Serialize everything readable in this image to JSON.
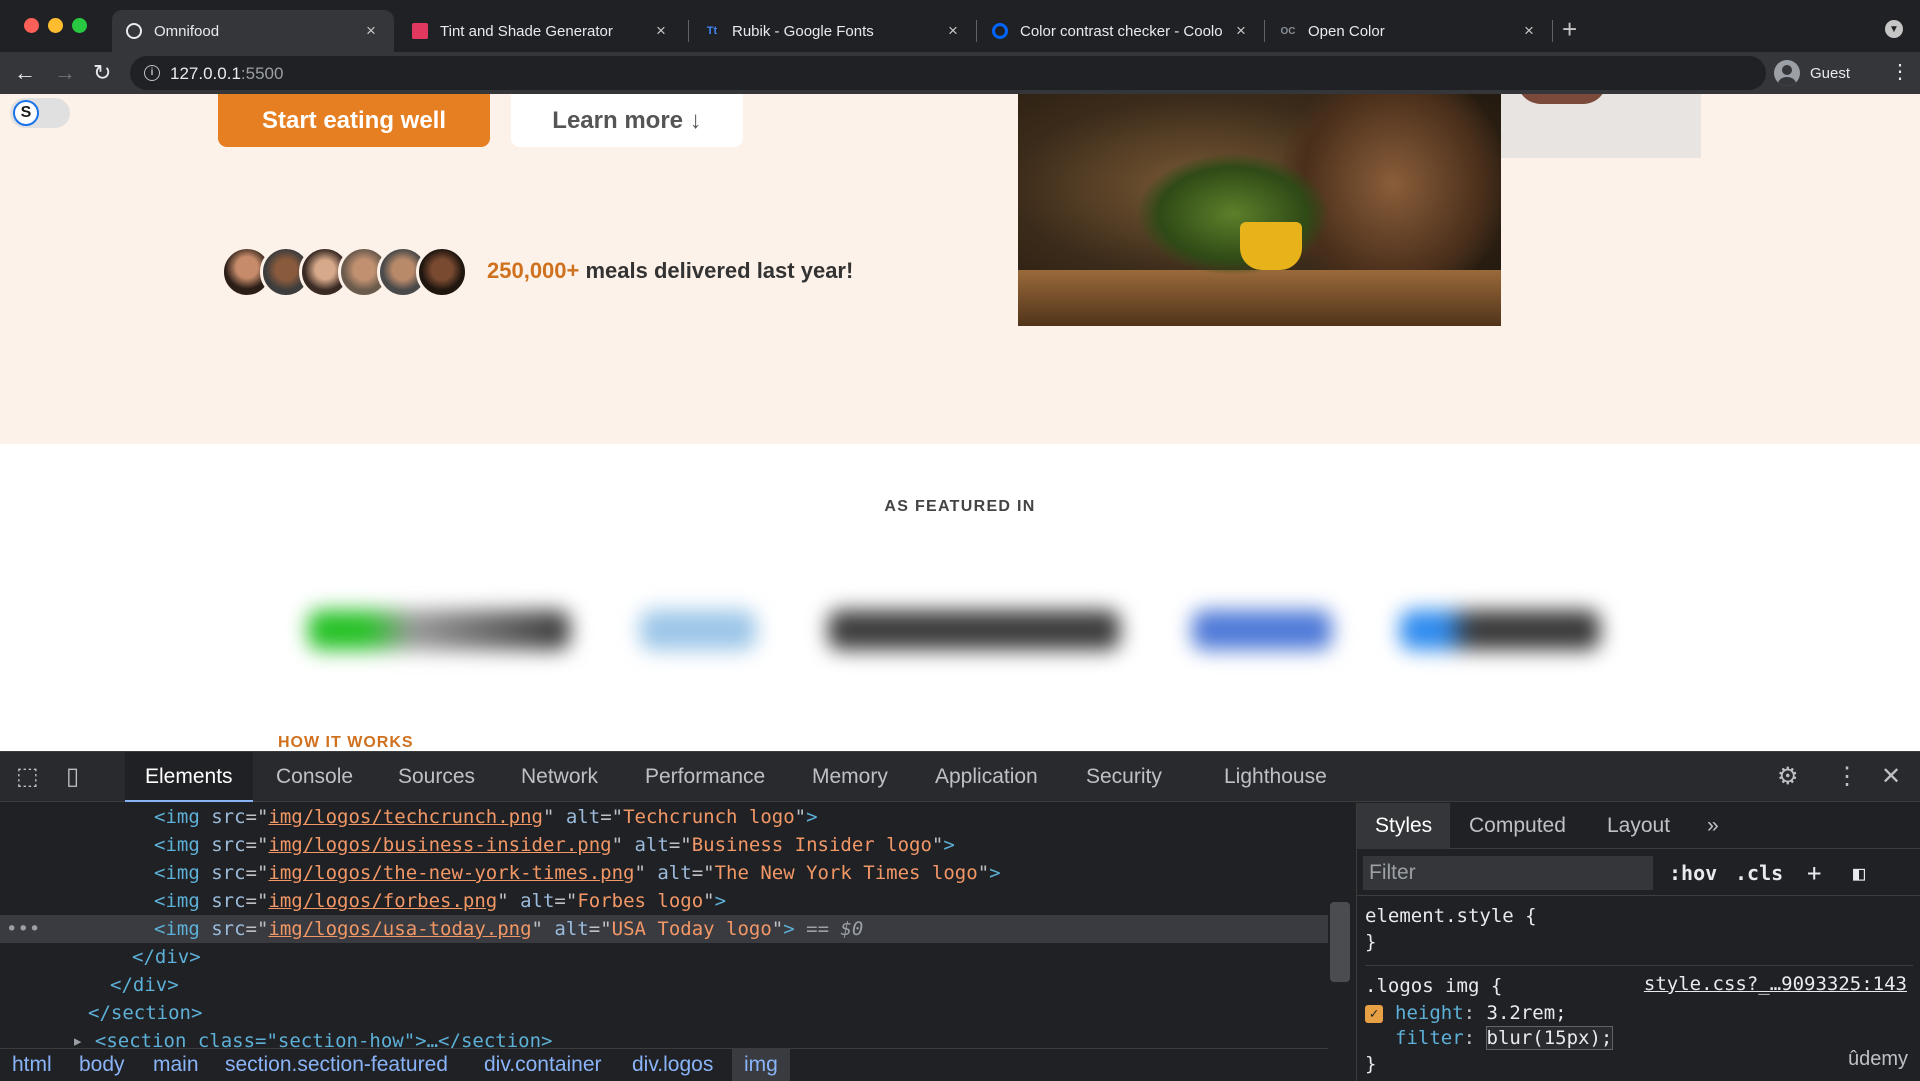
{
  "browser": {
    "tabs": [
      {
        "label": "Omnifood",
        "active": true
      },
      {
        "label": "Tint and Shade Generator",
        "active": false
      },
      {
        "label": "Rubik - Google Fonts",
        "active": false
      },
      {
        "label": "Color contrast checker - Coolo",
        "active": false
      },
      {
        "label": "Open Color",
        "active": false
      }
    ],
    "address": {
      "host": "127.0.0.1",
      "port": ":5500"
    },
    "profile": "Guest"
  },
  "page": {
    "cta_primary": "Start eating well",
    "cta_secondary": "Learn more ↓",
    "delivered_highlight": "250,000+",
    "delivered_text": " meals delivered last year!",
    "featured_title": "AS FEATURED IN",
    "how_title": "HOW IT WORKS",
    "colors": {
      "primary": "#e67e22",
      "hero_bg": "#fdf2e9",
      "highlight": "#cf711f"
    }
  },
  "devtools": {
    "tabs": [
      "Elements",
      "Console",
      "Sources",
      "Network",
      "Performance",
      "Memory",
      "Application",
      "Security",
      "Lighthouse"
    ],
    "dom_lines": [
      {
        "src": "img/logos/techcrunch.png",
        "alt": "Techcrunch logo"
      },
      {
        "src": "img/logos/business-insider.png",
        "alt": "Business Insider logo"
      },
      {
        "src": "img/logos/the-new-york-times.png",
        "alt": "The New York Times logo"
      },
      {
        "src": "img/logos/forbes.png",
        "alt": "Forbes logo"
      },
      {
        "src": "img/logos/usa-today.png",
        "alt": "USA Today logo",
        "selected": true
      }
    ],
    "closing": [
      "</div>",
      "</div>",
      "</section>"
    ],
    "partial_line": "<section class=\"section-how\">…</section>",
    "selected_marker": "== $0",
    "breadcrumbs": [
      "html",
      "body",
      "main",
      "section.section-featured",
      "div.container",
      "div.logos",
      "img"
    ],
    "styles_tabs": [
      "Styles",
      "Computed",
      "Layout",
      "»"
    ],
    "filter_placeholder": "Filter",
    "filter_tools": [
      ":hov",
      ".cls",
      "+"
    ],
    "element_style": "element.style {",
    "rule_selector": ".logos img {",
    "rule_source": "style.css?_…9093325:143",
    "rule_props": [
      {
        "name": "height",
        "value": "3.2rem;"
      },
      {
        "name": "filter",
        "value": "blur(15px);"
      }
    ],
    "brace_close": "}"
  },
  "watermark": "ûdemy"
}
